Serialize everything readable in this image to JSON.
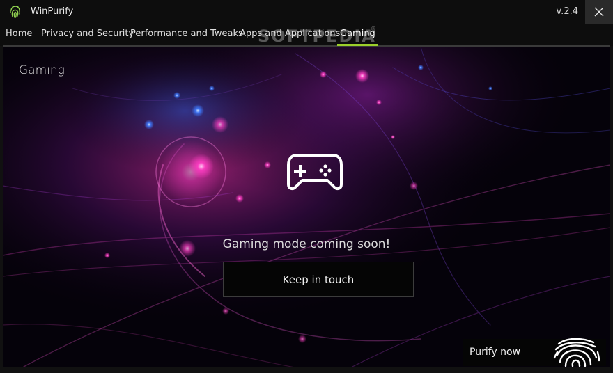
{
  "window": {
    "app_name": "WinPurify",
    "version": "v.2.4"
  },
  "nav": {
    "items": [
      {
        "label": "Home"
      },
      {
        "label": "Privacy and Security"
      },
      {
        "label": "Performance and Tweaks"
      },
      {
        "label": "Apps and Applications"
      },
      {
        "label": "Gaming"
      }
    ],
    "active": "Gaming"
  },
  "watermark": {
    "text": "SOFTPEDIA",
    "mark": "®"
  },
  "main": {
    "section_title": "Gaming",
    "icon": "gamepad-icon",
    "message": "Gaming mode coming soon!",
    "button_label": "Keep in touch"
  },
  "footer": {
    "purify_label": "Purify now",
    "purify_icon": "fingerprint-icon"
  },
  "colors": {
    "accent": "#9ccf2b",
    "background": "#05020a",
    "titlebar": "#0d0d0d"
  }
}
